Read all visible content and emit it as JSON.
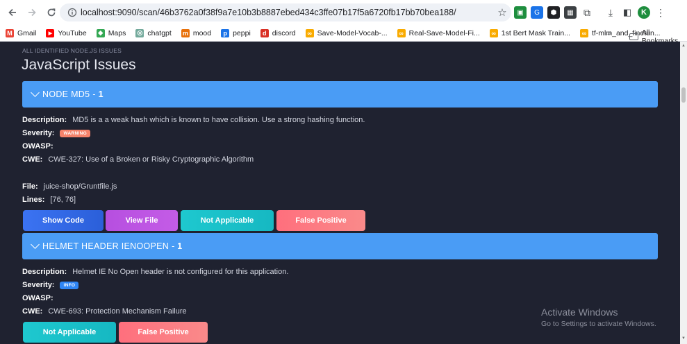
{
  "browser": {
    "url": "localhost:9090/scan/46b3762a0f38f9a7e10b3b8887ebed434c3ffe07b17f5a6720fb17bb70bea188/",
    "profile_initial": "K",
    "bookmarks": [
      {
        "label": "Gmail",
        "icon": "gmail-icon",
        "color": "#ea4335",
        "glyph": "M"
      },
      {
        "label": "YouTube",
        "icon": "youtube-icon",
        "color": "#ff0000",
        "glyph": "▶"
      },
      {
        "label": "Maps",
        "icon": "maps-icon",
        "color": "#34a853",
        "glyph": "◆"
      },
      {
        "label": "chatgpt",
        "icon": "chatgpt-icon",
        "color": "#74aa9c",
        "glyph": "◎"
      },
      {
        "label": "mood",
        "icon": "mood-icon",
        "color": "#e8710a",
        "glyph": "m"
      },
      {
        "label": "peppi",
        "icon": "peppi-icon",
        "color": "#1a73e8",
        "glyph": "p"
      },
      {
        "label": "discord",
        "icon": "discord-icon",
        "color": "#d93025",
        "glyph": "d"
      },
      {
        "label": "Save-Model-Vocab-...",
        "icon": "colab-icon",
        "color": "#f9ab00",
        "glyph": "∞"
      },
      {
        "label": "Real-Save-Model-Fi...",
        "icon": "colab-icon",
        "color": "#f9ab00",
        "glyph": "∞"
      },
      {
        "label": "1st Bert Mask Train...",
        "icon": "colab-icon",
        "color": "#f9ab00",
        "glyph": "∞"
      },
      {
        "label": "tf-mlm_and_finetun...",
        "icon": "colab-icon",
        "color": "#f9ab00",
        "glyph": "∞"
      }
    ],
    "more": "»",
    "all_bookmarks": "All Bookmarks"
  },
  "section": {
    "subtitle": "ALL IDENTIFIED NODE.JS ISSUES",
    "title": "JavaScript Issues"
  },
  "labels": {
    "description": "Description:",
    "severity": "Severity:",
    "owasp": "OWASP:",
    "cwe": "CWE:",
    "file": "File:",
    "lines": "Lines:",
    "separator": "-"
  },
  "issues": [
    {
      "name": "NODE MD5",
      "count": "1",
      "description": "MD5 is a a weak hash which is known to have collision. Use a strong hashing function.",
      "severity": "WARNING",
      "severity_color": "#f5836b",
      "owasp": "",
      "cwe": "CWE-327: Use of a Broken or Risky Cryptographic Algorithm",
      "file": "juice-shop/Gruntfile.js",
      "lines": "[76, 76]",
      "buttons": [
        "Show Code",
        "View File",
        "Not Applicable",
        "False Positive"
      ]
    },
    {
      "name": "HELMET HEADER IENOOPEN",
      "count": "1",
      "description": "Helmet IE No Open header is not configured for this application.",
      "severity": "INFO",
      "severity_color": "#2f86f5",
      "owasp": "",
      "cwe": "CWE-693: Protection Mechanism Failure",
      "buttons": [
        "Not Applicable",
        "False Positive"
      ]
    }
  ],
  "watermark": {
    "line1": "Activate Windows",
    "line2": "Go to Settings to activate Windows."
  }
}
